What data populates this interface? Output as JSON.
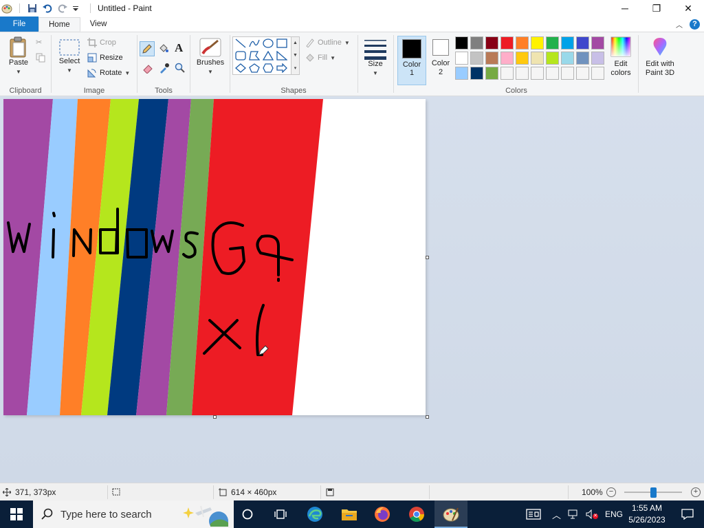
{
  "window": {
    "title": "Untitled - Paint",
    "minimize": "─",
    "maximize": "❐",
    "close": "✕"
  },
  "tabs": [
    {
      "label": "File"
    },
    {
      "label": "Home"
    },
    {
      "label": "View"
    }
  ],
  "ribbon": {
    "clipboard": {
      "label": "Clipboard",
      "paste": "Paste"
    },
    "image": {
      "label": "Image",
      "select": "Select",
      "crop": "Crop",
      "resize": "Resize",
      "rotate": "Rotate"
    },
    "tools": {
      "label": "Tools"
    },
    "brushes": {
      "label": "Brushes"
    },
    "shapes": {
      "label": "Shapes",
      "outline": "Outline",
      "fill": "Fill"
    },
    "size": {
      "label": "Size"
    },
    "colors": {
      "label": "Colors",
      "color1_label": "Color",
      "color1_num": "1",
      "color2_label": "Color",
      "color2_num": "2",
      "color1_value": "#000000",
      "color2_value": "#ffffff",
      "edit_colors_line1": "Edit",
      "edit_colors_line2": "colors",
      "paint3d_line1": "Edit with",
      "paint3d_line2": "Paint 3D",
      "palette": [
        "#000000",
        "#7f7f7f",
        "#880015",
        "#ed1c24",
        "#ff7f27",
        "#fff200",
        "#22b14c",
        "#00a2e8",
        "#3f48cc",
        "#a349a4",
        "#ffffff",
        "#c3c3c3",
        "#b97a57",
        "#ffaec9",
        "#ffc90e",
        "#efe4b0",
        "#b5e61d",
        "#99d9ea",
        "#7092be",
        "#c8bfe7",
        "#99ccff",
        "#003366",
        "#77aa44",
        "#f5f5f5",
        "#f5f5f5",
        "#f5f5f5",
        "#f5f5f5",
        "#f5f5f5",
        "#f5f5f5",
        "#f5f5f5"
      ]
    }
  },
  "canvas": {
    "stripe_colors": [
      "#a349a4",
      "#99ccff",
      "#ff7f27",
      "#b5e61d",
      "#003a80",
      "#a349a4",
      "#77aa55",
      "#ed1c24",
      "#ffffff"
    ]
  },
  "status": {
    "cursor_pos": "371, 373px",
    "image_size": "614 × 460px",
    "zoom": "100%"
  },
  "taskbar": {
    "search_placeholder": "Type here to search",
    "language": "ENG",
    "time": "1:55 AM",
    "date": "5/26/2023"
  }
}
